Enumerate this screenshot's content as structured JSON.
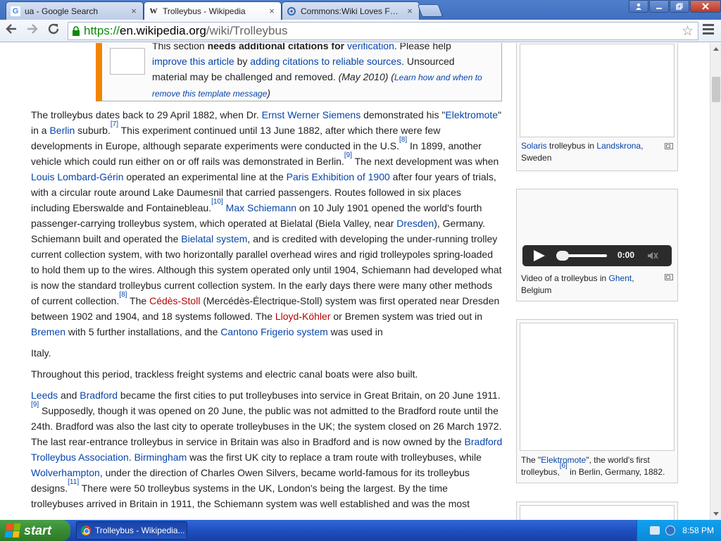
{
  "tabs": [
    {
      "title": "ua - Google Search",
      "favicon": "google-icon"
    },
    {
      "title": "Trolleybus - Wikipedia",
      "favicon": "wikipedia-icon"
    },
    {
      "title": "Commons:Wiki Loves Folklore",
      "favicon": "commons-icon"
    }
  ],
  "tab_close_glyph": "×",
  "omnibox": {
    "scheme": "https://",
    "host": "en.wikipedia.org",
    "path": "/wiki/Trolleybus"
  },
  "ambox": {
    "line1_pre": "This section ",
    "line1_bold": "needs additional citations for ",
    "line1_link": "verification",
    "line1_post": ". Please help",
    "link_improve": "improve this article",
    "by": " by ",
    "link_adding": "adding citations to reliable sources",
    "line2_post": ". Unsourced",
    "line3": "material may be challenged and removed. ",
    "date": "(May 2010)",
    "open_paren": " (",
    "learn_link": "Learn how and when to",
    "remove_link": "remove this template message",
    "close_paren": ")"
  },
  "para1": {
    "t1": "The trolleybus dates back to 29 April 1882, when Dr. ",
    "l_siemens": "Ernst Werner Siemens",
    "t2": " demonstrated his \"",
    "l_elektromote": "Elektromote",
    "t3": "\" in a ",
    "l_berlin": "Berlin",
    "t4": " suburb.",
    "ref7": "[7]",
    "t5": " This experiment continued until 13 June 1882, after which there were few developments in Europe, although separate experiments were conducted in the U.S.",
    "ref8": "[8]",
    "t6": " In 1899, another vehicle which could run either on or off rails was demonstrated in Berlin.",
    "ref9": "[9]",
    "t7": " The next development was when ",
    "l_lombard": "Louis Lombard-Gérin",
    "t8": " operated an experimental line at the ",
    "l_paris": "Paris Exhibition of 1900",
    "t9": " after four years of trials, with a circular route around Lake Daumesnil that carried passengers. Routes followed in six places including Eberswalde and Fontainebleau.",
    "ref10": "[10]",
    "t10": " ",
    "l_schiemann": "Max Schiemann",
    "t11": " on 10 July 1901 opened the world's fourth passenger-carrying trolleybus system, which operated at Bielatal (Biela Valley, near ",
    "l_dresden": "Dresden",
    "t12": "), Germany. Schiemann built and operated the ",
    "l_bielatal": "Bielatal system",
    "t13": ", and is credited with developing the under-running trolley current collection system, with two horizontally parallel overhead wires and rigid trolleypoles spring-loaded to hold them up to the wires. Although this system operated only until 1904, Schiemann had developed what is now the standard trolleybus current collection system. In the early days there were many other methods of current collection.",
    "ref8b": "[8]",
    "t14": " The ",
    "l_cedes": "Cédès-Stoll",
    "t15": " (Mercédès-Électrique-Stoll) system was first operated near Dresden between 1902 and 1904, and 18 systems followed. The ",
    "l_lloyd": "Lloyd-Köhler",
    "t16": " or Bremen system was tried out in ",
    "l_bremen": "Bremen",
    "t17": " with 5 further installations, and the ",
    "l_cantono": "Cantono Frigerio system",
    "t18": " was used in",
    "t19": "Italy."
  },
  "para2": "Throughout this period, trackless freight systems and electric canal boats were also built.",
  "para3": {
    "l_leeds": "Leeds",
    "t1": " and ",
    "l_bradford": "Bradford",
    "t2": " became the first cities to put trolleybuses into service in Great Britain, on 20 June 1911.",
    "ref9": "[9]",
    "t3": " Supposedly, though it was opened on 20 June, the public was not admitted to the Bradford route until the 24th. Bradford was also the last city to operate trolleybuses in the UK; the system closed on 26 March 1972. The last rear-entrance trolleybus in service in Britain was also in Bradford and is now owned by the ",
    "l_bta": "Bradford Trolleybus Association",
    "t4": ". ",
    "l_birmingham": "Birmingham",
    "t5": " was the first UK city to replace a tram route with trolleybuses, while ",
    "l_wolverhampton": "Wolverhampton",
    "t6": ", under the direction of Charles Owen Silvers, became world-famous for its trolleybus designs.",
    "ref11": "[11]",
    "t7": " There were 50 trolleybus systems in the UK, London's being the largest. By the time trolleybuses arrived in Britain in 1911, the Schiemann system was well established and was the most"
  },
  "side1": {
    "l_solaris": "Solaris",
    "t1": " trolleybus in ",
    "l_landskrona": "Landskrona",
    "t2": ", Sweden"
  },
  "side2": {
    "t1": "Video of a trolleybus in ",
    "l_ghent": "Ghent",
    "t2": ", Belgium",
    "time": "0:00"
  },
  "side3": {
    "t1": "The \"",
    "l_elektromote": "Elektromote",
    "t2": "\", the world's first trolleybus,",
    "ref6": "[6]",
    "t3": " in Berlin, Germany, 1882."
  },
  "taskbar": {
    "start": "start",
    "item": "Trolleybus - Wikipedia...",
    "clock": "8:58 PM"
  },
  "colors": {
    "link": "#0645ad",
    "redlink": "#ba0000",
    "ambox_accent": "#f28500"
  }
}
